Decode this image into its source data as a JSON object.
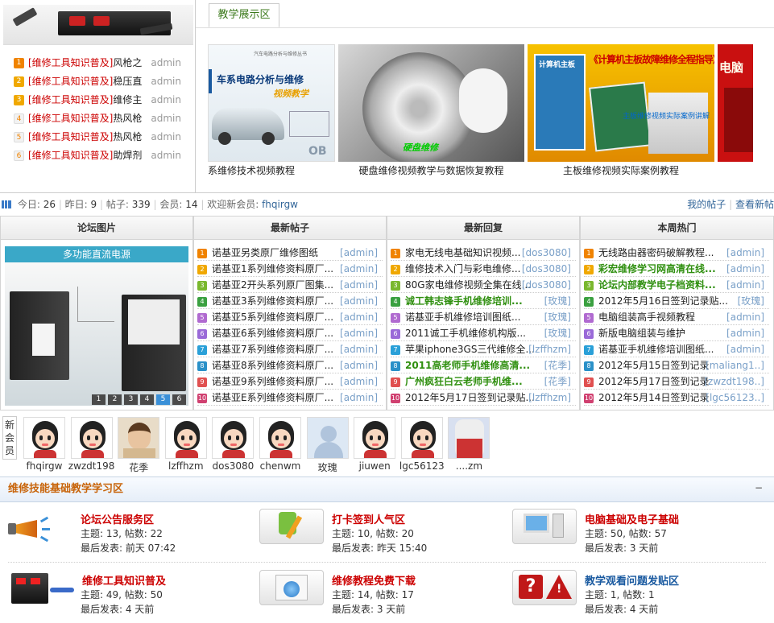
{
  "top_list": [
    {
      "num": "1",
      "prefix": "[维修工具知识普及]",
      "title": "风枪之",
      "author": "admin"
    },
    {
      "num": "2",
      "prefix": "[维修工具知识普及]",
      "title": "稳压直",
      "author": "admin"
    },
    {
      "num": "3",
      "prefix": "[维修工具知识普及]",
      "title": "维修主",
      "author": "admin"
    },
    {
      "num": "4",
      "prefix": "[维修工具知识普及]",
      "title": "热风枪",
      "author": "admin"
    },
    {
      "num": "5",
      "prefix": "[维修工具知识普及]",
      "title": "热风枪",
      "author": "admin"
    },
    {
      "num": "6",
      "prefix": "[维修工具知识普及]",
      "title": "助焊剂",
      "author": "admin"
    }
  ],
  "showcase": {
    "tab": "教学展示区",
    "items": [
      {
        "caption": "系维修技术视频教程",
        "img_text": "车系电路分析与维修"
      },
      {
        "caption": "硬盘维修视频教学与数据恢复教程",
        "img_text": "硬盘维修"
      },
      {
        "caption": "主板维修视频实际案例教程",
        "img_text": "《计算机主板故障维修全程指导》"
      },
      {
        "caption": "",
        "img_text": "电脑"
      }
    ],
    "tag1": "汽车电路分析与维修丛书",
    "tag2": "视频教学",
    "tag3": "计算机主板",
    "tag4": "主板维修视频实际案例讲解"
  },
  "stats": {
    "today_label": "今日:",
    "today": "26",
    "yesterday_label": "昨日:",
    "yesterday": "9",
    "posts_label": "帖子:",
    "posts": "339",
    "members_label": "会员:",
    "members": "14",
    "welcome": "欢迎新会员:",
    "newest": "fhqirgw",
    "link_my": "我的帖子",
    "link_new": "查看新帖"
  },
  "columns": {
    "pics_title": "论坛图片",
    "pic_caption": "多功能直流电源",
    "pic_pages": [
      "1",
      "2",
      "3",
      "4",
      "5",
      "6"
    ],
    "latest_title": "最新帖子",
    "latest": [
      {
        "i": "1",
        "t": "诺基亚另类原厂维修图纸",
        "a": "[admin]",
        "c": "#f08300"
      },
      {
        "i": "2",
        "t": "诺基亚1系列维修资料原厂...",
        "a": "[admin]",
        "c": "#f0a800"
      },
      {
        "i": "3",
        "t": "诺基亚2开头系列原厂图集...",
        "a": "[admin]",
        "c": "#7ab82e"
      },
      {
        "i": "4",
        "t": "诺基亚3系列维修资料原厂...",
        "a": "[admin]",
        "c": "#3aa040"
      },
      {
        "i": "5",
        "t": "诺基亚5系列维修资料原厂...",
        "a": "[admin]",
        "c": "#b06ad0"
      },
      {
        "i": "6",
        "t": "诺基亚6系列维修资料原厂...",
        "a": "[admin]",
        "c": "#9a6ad8"
      },
      {
        "i": "7",
        "t": "诺基亚7系列维修资料原厂...",
        "a": "[admin]",
        "c": "#2aa0d8"
      },
      {
        "i": "8",
        "t": "诺基亚8系列维修资料原厂...",
        "a": "[admin]",
        "c": "#2a90c8"
      },
      {
        "i": "9",
        "t": "诺基亚9系列维修资料原厂...",
        "a": "[admin]",
        "c": "#e05050"
      },
      {
        "i": "10",
        "t": "诺基亚E系列维修资料原厂...",
        "a": "[admin]",
        "c": "#d04070"
      }
    ],
    "replies_title": "最新回复",
    "replies": [
      {
        "i": "1",
        "t": "家电无线电基础知识视频...",
        "a": "[dos3080]",
        "c": "#f08300",
        "g": false
      },
      {
        "i": "2",
        "t": "维修技术入门与彩电维修...",
        "a": "[dos3080]",
        "c": "#f0a800",
        "g": false
      },
      {
        "i": "3",
        "t": "80G家电维修视频全集在线...",
        "a": "[dos3080]",
        "c": "#7ab82e",
        "g": false
      },
      {
        "i": "4",
        "t": "诚工韩志锋手机维修培训...",
        "a": "[玫瑰]",
        "c": "#3aa040",
        "g": true
      },
      {
        "i": "5",
        "t": "诺基亚手机维修培训图纸...",
        "a": "[玫瑰]",
        "c": "#b06ad0",
        "g": false
      },
      {
        "i": "6",
        "t": "2011诚工手机维修机构版...",
        "a": "[玫瑰]",
        "c": "#9a6ad8",
        "g": false
      },
      {
        "i": "7",
        "t": "苹果iphone3GS三代维修全...",
        "a": "[lzffhzm]",
        "c": "#2aa0d8",
        "g": false
      },
      {
        "i": "8",
        "t": "2011高老师手机维修高清...",
        "a": "[花季]",
        "c": "#2a90c8",
        "g": true
      },
      {
        "i": "9",
        "t": "广州疯狂白云老师手机维...",
        "a": "[花季]",
        "c": "#e05050",
        "g": true
      },
      {
        "i": "10",
        "t": "2012年5月17日签到记录贴...",
        "a": "[lzffhzm]",
        "c": "#d04070",
        "g": false
      }
    ],
    "hot_title": "本周热门",
    "hot": [
      {
        "i": "1",
        "t": "无线路由器密码破解教程...",
        "a": "[admin]",
        "c": "#f08300",
        "g": false
      },
      {
        "i": "2",
        "t": "彩宏维修学习网高清在线...",
        "a": "[admin]",
        "c": "#f0a800",
        "g": true
      },
      {
        "i": "3",
        "t": "论坛内部教学电子档资料...",
        "a": "[admin]",
        "c": "#7ab82e",
        "g": true
      },
      {
        "i": "4",
        "t": "2012年5月16日签到记录贴...",
        "a": "[玫瑰]",
        "c": "#3aa040",
        "g": false
      },
      {
        "i": "5",
        "t": "电脑组装高手视频教程",
        "a": "[admin]",
        "c": "#b06ad0",
        "g": false
      },
      {
        "i": "6",
        "t": "新版电脑组装与维护",
        "a": "[admin]",
        "c": "#9a6ad8",
        "g": false
      },
      {
        "i": "7",
        "t": "诺基亚手机维修培训图纸...",
        "a": "[admin]",
        "c": "#2aa0d8",
        "g": false
      },
      {
        "i": "8",
        "t": "2012年5月15日签到记录",
        "a": "[maliang1..]",
        "c": "#2a90c8",
        "g": false
      },
      {
        "i": "9",
        "t": "2012年5月17日签到记录",
        "a": "[zwzdt198..]",
        "c": "#e05050",
        "g": false
      },
      {
        "i": "10",
        "t": "2012年5月14日签到记录",
        "a": "[lgc56123..]",
        "c": "#d04070",
        "g": false
      }
    ]
  },
  "new_members": {
    "label": "新会员",
    "members": [
      "fhqirgw",
      "zwzdt198",
      "花季",
      "lzffhzm",
      "dos3080",
      "chenwm",
      "玫瑰",
      "jiuwen",
      "lgc56123",
      "....zm"
    ]
  },
  "forum_section": {
    "title": "维修技能基础教学学习区",
    "collapse": "−",
    "forums": [
      {
        "name": "论坛公告服务区",
        "topics": "主题: 13, 帖数: 22",
        "last": "最后发表: 前天 07:42",
        "icon": "megaphone-icon",
        "blue": false
      },
      {
        "name": "打卡签到人气区",
        "topics": "主题: 10, 帖数: 20",
        "last": "最后发表: 昨天 15:40",
        "icon": "sign-in-icon",
        "blue": false
      },
      {
        "name": "电脑基础及电子基础",
        "topics": "主题: 50, 帖数: 57",
        "last": "最后发表: 3 天前",
        "icon": "computer-icon",
        "blue": false
      },
      {
        "name": "维修工具知识普及",
        "topics": "主题: 49, 帖数: 50",
        "last": "最后发表: 4 天前",
        "icon": "solder-station-icon",
        "blue": false
      },
      {
        "name": "维修教程免费下载",
        "topics": "主题: 14, 帖数: 17",
        "last": "最后发表: 3 天前",
        "icon": "download-folder-icon",
        "blue": false
      },
      {
        "name": "教学观看问题发贴区",
        "topics": "主题: 1, 帖数: 1",
        "last": "最后发表: 4 天前",
        "icon": "question-warning-icon",
        "blue": true
      }
    ]
  }
}
